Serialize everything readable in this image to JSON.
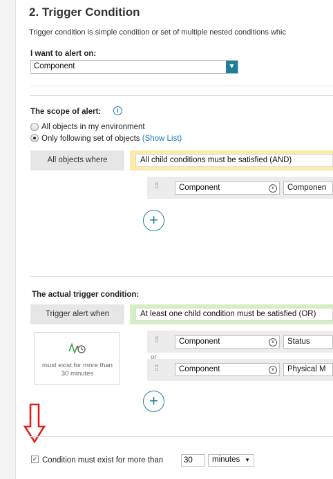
{
  "section": {
    "title": "2. Trigger Condition",
    "description": "Trigger condition is simple condition or set of multiple nested conditions whic"
  },
  "alert_on": {
    "label": "I want to alert on:",
    "value": "Component"
  },
  "scope": {
    "label": "The scope of alert:",
    "options": [
      {
        "label": "All objects in my environment",
        "selected": false
      },
      {
        "label": "Only following set of objects",
        "selected": true
      }
    ],
    "show_list": "(Show List)",
    "where_label": "All objects where",
    "group_condition": "All child conditions must be satisfied (AND)",
    "rows": [
      {
        "field": "Component",
        "value": "Componen"
      }
    ]
  },
  "trigger": {
    "label": "The actual trigger condition:",
    "when_label": "Trigger alert when",
    "group_condition": "At least one child condition must be satisfied (OR)",
    "or_label": "or",
    "rows": [
      {
        "field": "Component",
        "value": "Status"
      },
      {
        "field": "Component",
        "value": "Physical M"
      }
    ],
    "card_text": "must exist for more than 30 minutes"
  },
  "footer": {
    "checkbox_checked": true,
    "checkbox_label": "Condition must exist for more than",
    "duration_value": "30",
    "unit_value": "minutes"
  },
  "colors": {
    "accent": "#1d7f98",
    "and_highlight": "#fde9a8",
    "or_highlight": "#d6eec4",
    "arrow": "#e02020"
  }
}
